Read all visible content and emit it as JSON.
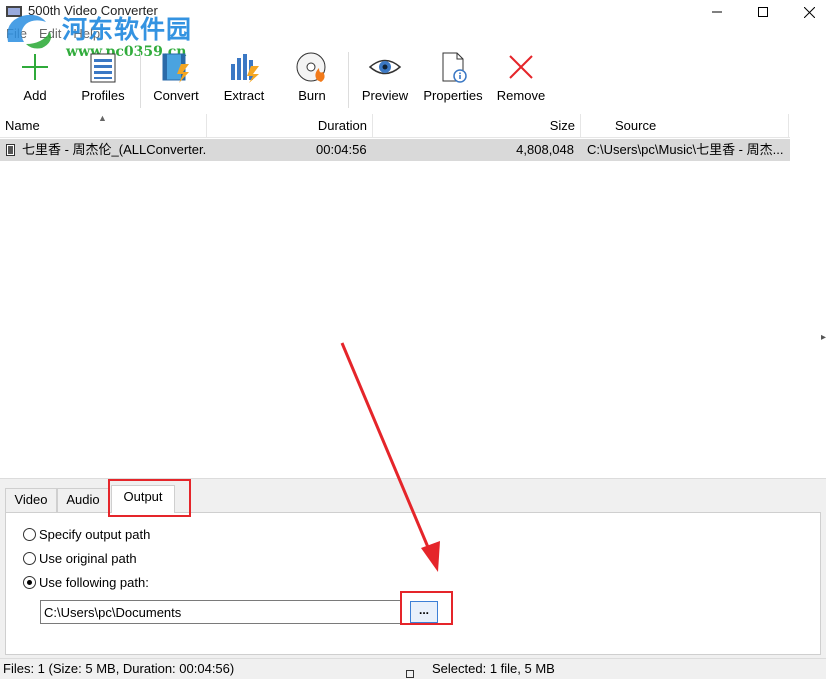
{
  "window": {
    "title": "500th Video Converter"
  },
  "watermark": {
    "line1": "河东软件园",
    "line2": "www.pc0359.cn"
  },
  "menu": [
    "File",
    "Edit",
    "Help"
  ],
  "toolbar": {
    "add": "Add",
    "profiles": "Profiles",
    "convert": "Convert",
    "extract": "Extract",
    "burn": "Burn",
    "preview": "Preview",
    "properties": "Properties",
    "remove": "Remove"
  },
  "file_list": {
    "columns": {
      "name": "Name",
      "duration": "Duration",
      "size": "Size",
      "source": "Source"
    },
    "rows": [
      {
        "name": "七里香 - 周杰伦_(ALLConverter...",
        "duration": "00:04:56",
        "size": "4,808,048",
        "source": "C:\\Users\\pc\\Music\\七里香 - 周杰..."
      }
    ]
  },
  "tabs": {
    "video": "Video",
    "audio": "Audio",
    "output": "Output",
    "selected": "Output"
  },
  "output": {
    "options": [
      {
        "label": "Specify output path",
        "selected": false
      },
      {
        "label": "Use original path",
        "selected": false
      },
      {
        "label": "Use following path:",
        "selected": true
      }
    ],
    "path": "C:\\Users\\pc\\Documents",
    "browse_label": "..."
  },
  "status": {
    "left": "Files: 1 (Size: 5 MB, Duration: 00:04:56)",
    "right": "Selected: 1 file, 5 MB"
  },
  "colors": {
    "annotation": "#e5252a",
    "row_selected": "#d9d9d9",
    "watermark_blue": "#2a8ee0",
    "watermark_green": "#27a832"
  }
}
